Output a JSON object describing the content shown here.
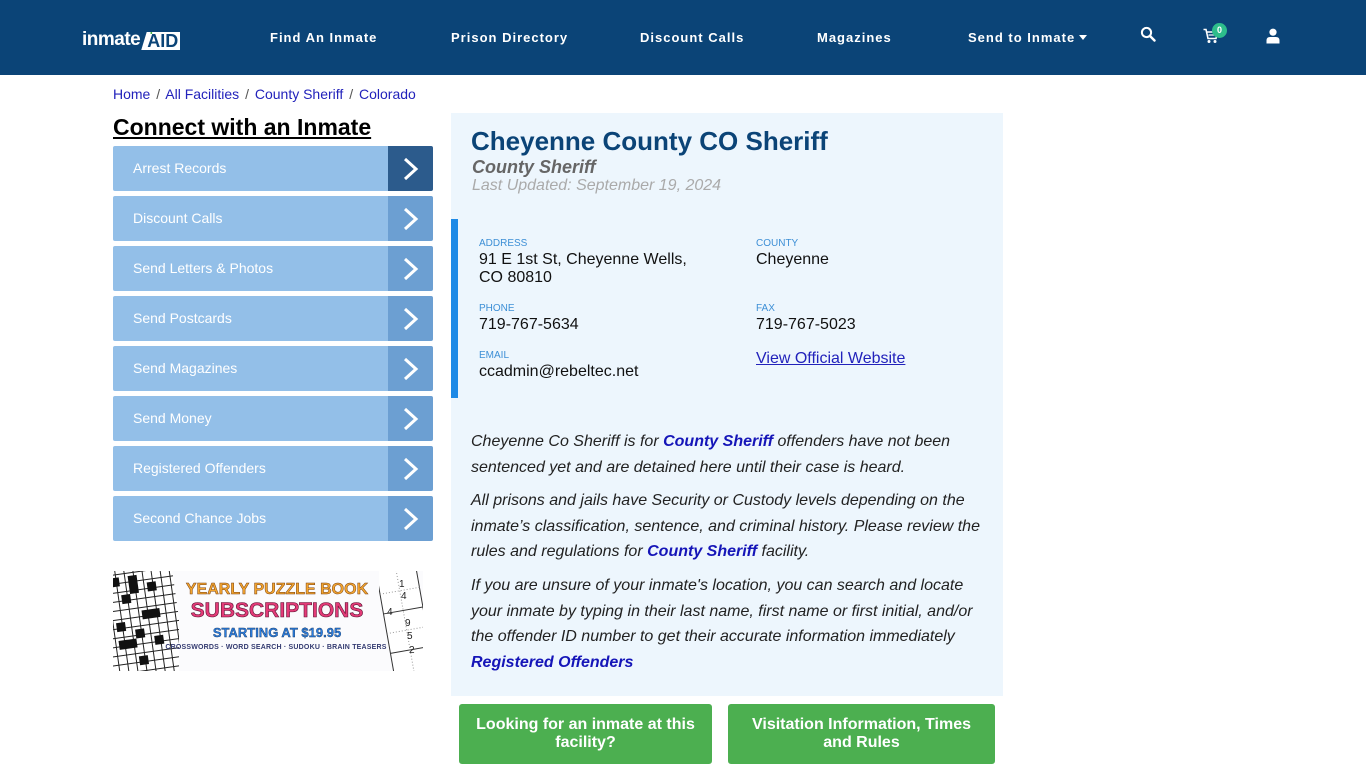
{
  "header": {
    "logo": {
      "part1": "inmate",
      "part2": "AID",
      "plus": "+"
    },
    "nav": [
      {
        "label": "Find An Inmate"
      },
      {
        "label": "Prison Directory"
      },
      {
        "label": "Discount Calls"
      },
      {
        "label": "Magazines"
      },
      {
        "label": "Send to Inmate",
        "has_dropdown": true
      }
    ],
    "icons": [
      "search-icon",
      "cart-icon",
      "user-icon"
    ],
    "cart_count": "0",
    "colors": {
      "bar": "#0b4477",
      "badge": "#2dbd8b"
    }
  },
  "breadcrumb": [
    {
      "label": "Home"
    },
    {
      "label": "All Facilities"
    },
    {
      "label": "County Sheriff"
    },
    {
      "label": "Colorado"
    }
  ],
  "breadcrumb_sep": "/",
  "sidebar": {
    "title": "Connect with an Inmate",
    "items": [
      {
        "label": "Arrest Records",
        "active": true
      },
      {
        "label": "Discount Calls"
      },
      {
        "label": "Send Letters & Photos"
      },
      {
        "label": "Send Postcards"
      },
      {
        "label": "Send Magazines"
      },
      {
        "label": "Send Money"
      },
      {
        "label": "Registered Offenders"
      },
      {
        "label": "Second Chance Jobs"
      }
    ],
    "ad": {
      "line1": "YEARLY PUZZLE BOOK",
      "line2": "SUBSCRIPTIONS",
      "line3": "STARTING AT $19.95",
      "line4": "CROSSWORDS · WORD SEARCH · SUDOKU · BRAIN TEASERS",
      "sudoku_digits": [
        "1",
        "4",
        "4",
        "9",
        "5",
        "2"
      ]
    }
  },
  "facility": {
    "name": "Cheyenne County CO Sheriff",
    "type": "County Sheriff",
    "last_updated": "Last Updated: September 19, 2024",
    "address_label": "ADDRESS",
    "address_line1": "91 E 1st St, Cheyenne Wells,",
    "address_line2": "CO 80810",
    "county_label": "COUNTY",
    "county": "Cheyenne",
    "phone_label": "PHONE",
    "phone": "719-767-5634",
    "fax_label": "FAX",
    "fax": "719-767-5023",
    "email_label": "EMAIL",
    "email": "ccadmin@rebeltec.net",
    "website_link": "View Official Website"
  },
  "description": {
    "p1_a": "Cheyenne Co Sheriff is for ",
    "p1_link": "County Sheriff",
    "p1_b": " offenders have not been sentenced yet and are detained here until their case is heard.",
    "p2_a": "All prisons and jails have Security or Custody levels depending on the inmate’s classification, sentence, and criminal history. Please review the rules and regulations for ",
    "p2_link": "County Sheriff",
    "p2_b": " facility.",
    "p3": "If you are unsure of your inmate's location, you can search and locate your inmate by typing in their last name, first name or first initial, and/or the offender ID number to get their accurate information immediately",
    "p3_link": "Registered Offenders"
  },
  "buttons": {
    "find_inmate": "Looking for an inmate at this facility?",
    "visitation": "Visitation Information, Times and Rules"
  }
}
